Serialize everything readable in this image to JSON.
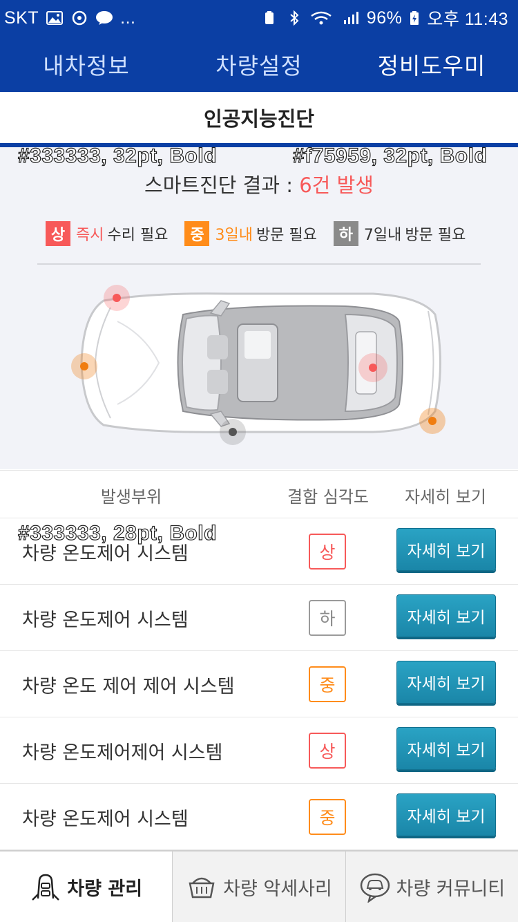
{
  "status_bar": {
    "carrier": "SKT",
    "more": "...",
    "battery": "96%",
    "time": "오후 11:43"
  },
  "top_tabs": [
    {
      "label": "내차정보",
      "active": false
    },
    {
      "label": "차량설정",
      "active": false
    },
    {
      "label": "정비도우미",
      "active": true
    }
  ],
  "sub_header": {
    "title": "인공지능진단"
  },
  "annotations": {
    "title_style": "#333333, 32pt, Bold",
    "count_style": "#f75959, 32pt, Bold",
    "row_style": "#333333, 28pt, Bold"
  },
  "result": {
    "label": "스마트진단 결과 : ",
    "count": "6건 발생"
  },
  "legend": [
    {
      "badge": "상",
      "emph": "즉시",
      "text": "수리 필요",
      "color": "#f75959"
    },
    {
      "badge": "중",
      "emph": "3일내",
      "text": "방문 필요",
      "color": "#ff8c1a"
    },
    {
      "badge": "하",
      "emph": "7일내",
      "text": "방문 필요",
      "color": "#8a8a8a"
    }
  ],
  "car_markers": [
    {
      "severity": "high",
      "color": "#f75959"
    },
    {
      "severity": "mid",
      "color": "#f0892a"
    },
    {
      "severity": "high",
      "color": "#f75959"
    },
    {
      "severity": "low",
      "color": "#555555"
    },
    {
      "severity": "mid",
      "color": "#f07d10"
    }
  ],
  "table": {
    "headers": [
      "발생부위",
      "결함 심각도",
      "자세히 보기"
    ],
    "rows": [
      {
        "name": "차량 온도제어 시스템",
        "severity": "상",
        "level": "high",
        "button": "자세히 보기"
      },
      {
        "name": "차량 온도제어 시스템",
        "severity": "하",
        "level": "low",
        "button": "자세히 보기"
      },
      {
        "name": "차량 온도 제어 제어 시스템",
        "severity": "중",
        "level": "mid",
        "button": "자세히 보기"
      },
      {
        "name": "차량 온도제어제어 시스템",
        "severity": "상",
        "level": "high",
        "button": "자세히 보기"
      },
      {
        "name": "차량 온도제어 시스템",
        "severity": "중",
        "level": "mid",
        "button": "자세히 보기"
      }
    ]
  },
  "bottom_nav": [
    {
      "label": "차량 관리",
      "icon": "car-manage-icon",
      "active": true
    },
    {
      "label": "차량 악세사리",
      "icon": "basket-icon",
      "active": false
    },
    {
      "label": "차량 커뮤니티",
      "icon": "car-chat-icon",
      "active": false
    }
  ],
  "colors": {
    "brand": "#0b3fa4",
    "high": "#f75959",
    "mid": "#ff8c1a",
    "low": "#8a8a8a",
    "button": "#1a86a8"
  }
}
